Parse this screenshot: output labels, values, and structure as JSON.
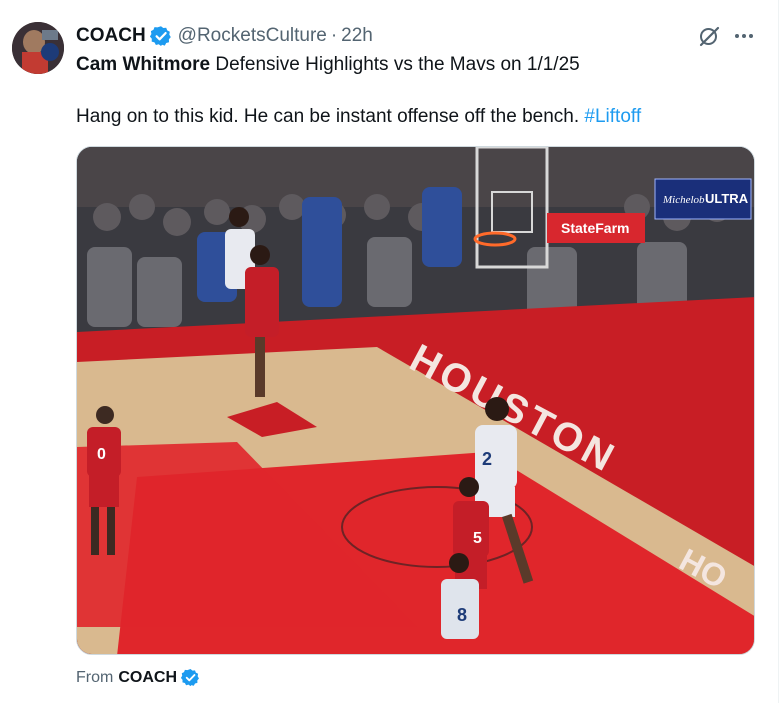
{
  "tweet": {
    "author_name": "COACH",
    "handle": "@RocketsCulture",
    "separator": "·",
    "time": "22h",
    "text_bold": "Cam Whitmore",
    "text_rest": " Defensive Highlights vs the Mavs on 1/1/25",
    "body_text": "Hang on to this kid. He can be instant offense off the bench. ",
    "hashtag": "#Liftoff"
  },
  "media": {
    "description_icon": "video-thumbnail",
    "court_text": "HOUSTON",
    "sign_statefarm": "StateFarm",
    "sign_ultra": "ULTRA",
    "sign_michelob": "Michelob",
    "jersey_left": "0",
    "jersey_center": "2",
    "jersey_right": "5",
    "jersey_bottom": "8"
  },
  "footer": {
    "from_label": "From",
    "source_name": "COACH"
  },
  "colors": {
    "verified_blue": "#1d9bf0",
    "link_blue": "#1d9bf0",
    "secondary_text": "#536471",
    "court_red": "#e0262b",
    "court_wood": "#d9b98f"
  },
  "icons": [
    "verified-badge-icon",
    "grok-icon",
    "more-options-icon"
  ]
}
